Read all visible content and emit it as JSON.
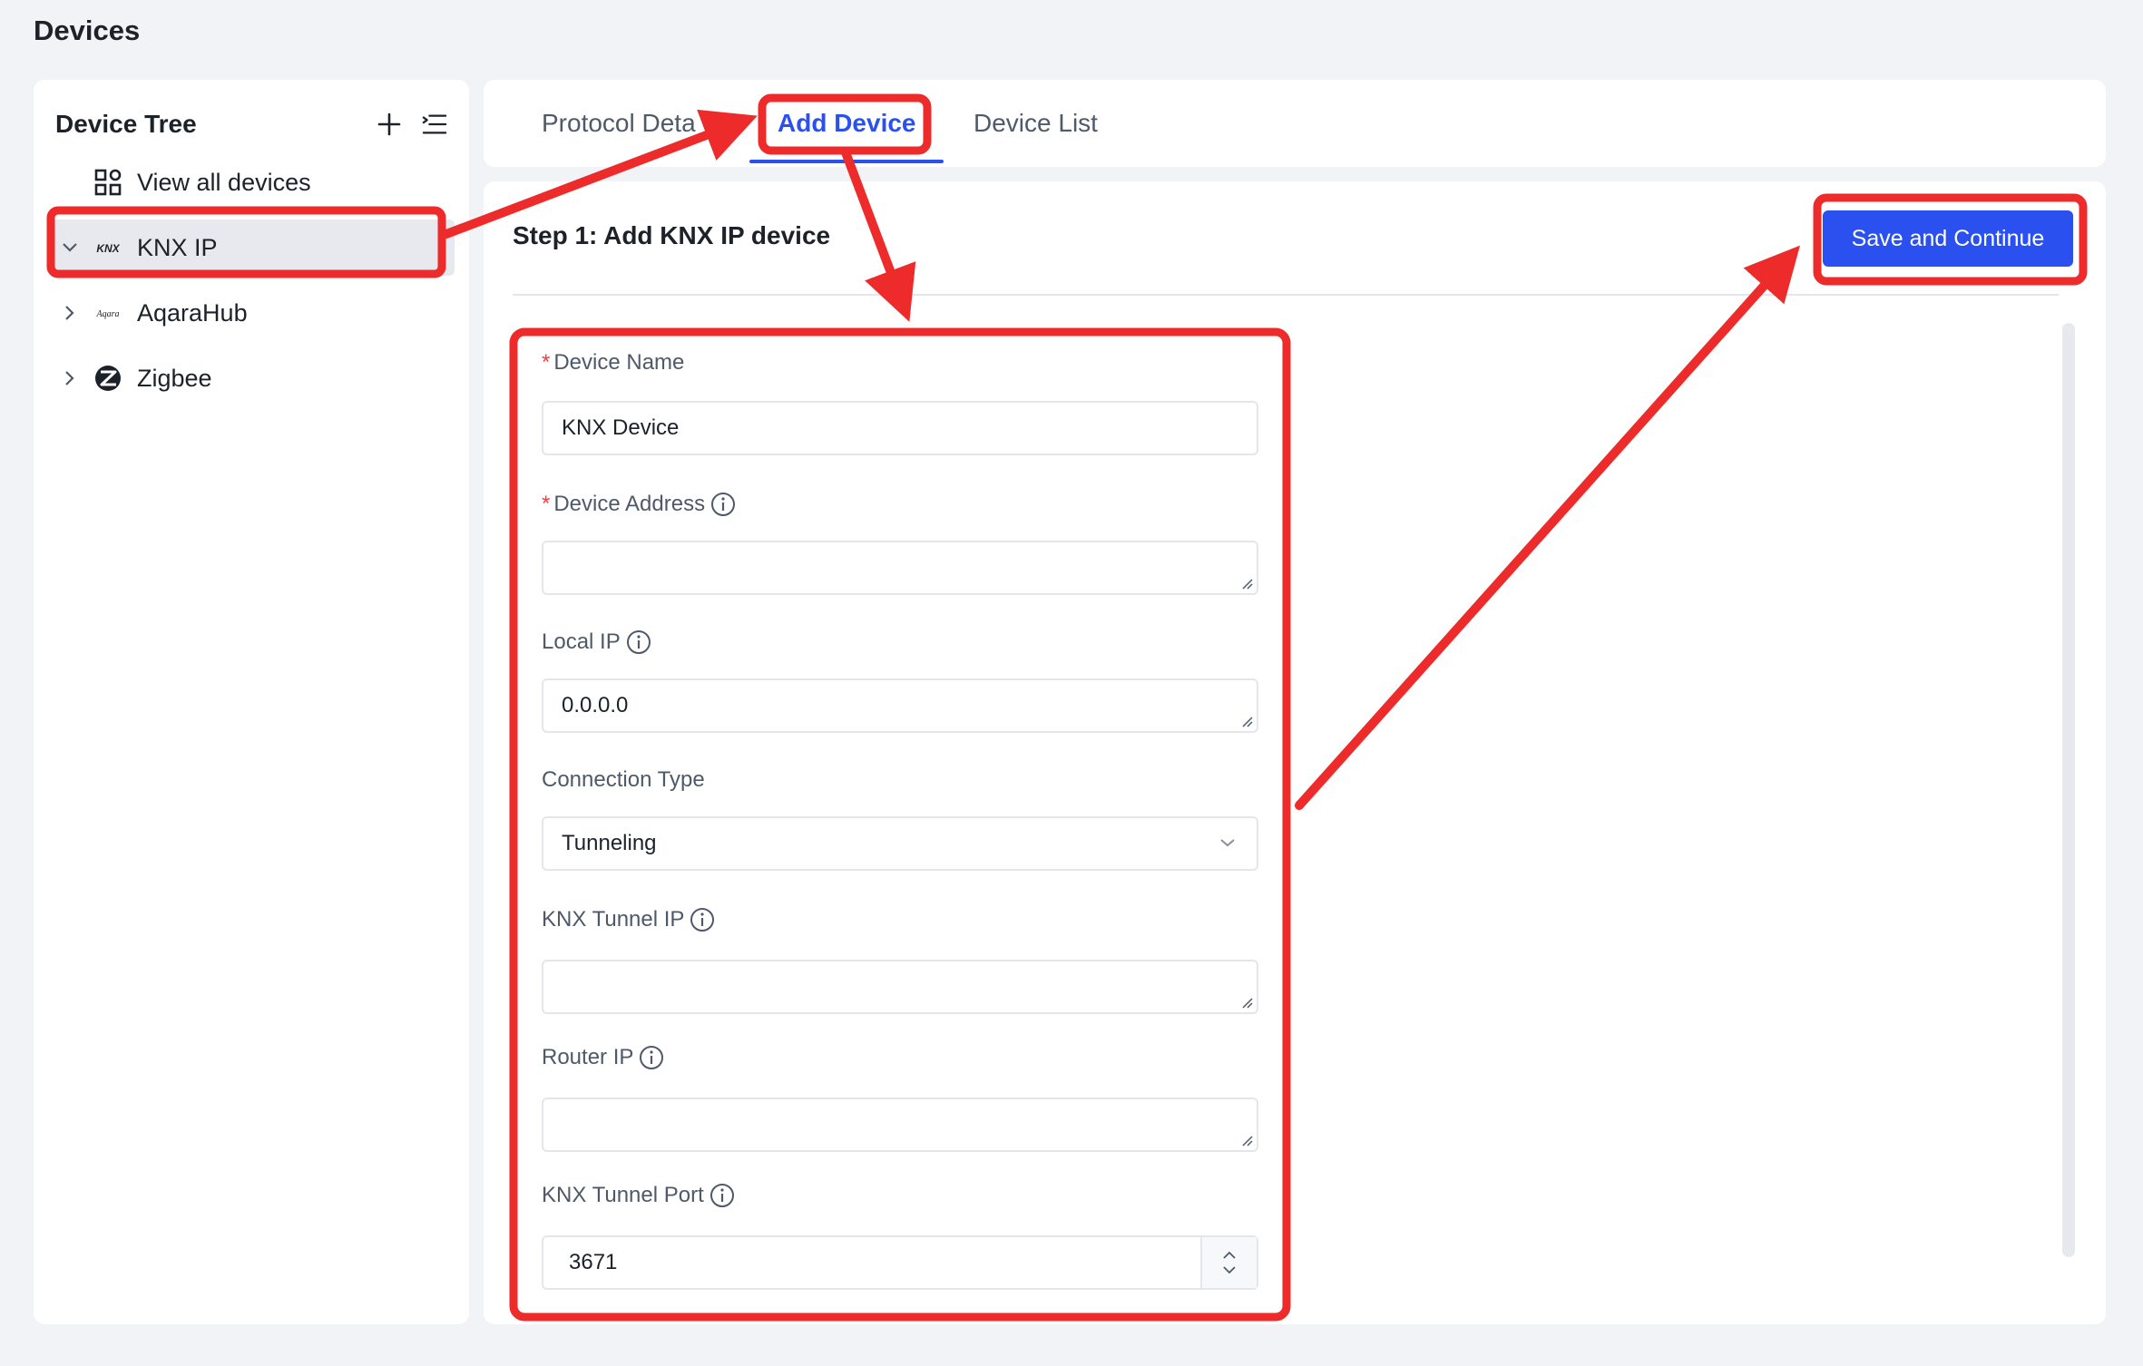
{
  "page": {
    "title": "Devices"
  },
  "sidebar": {
    "title": "Device Tree",
    "items": [
      {
        "label": "View all devices",
        "icon": "grid-icon"
      },
      {
        "label": "KNX IP",
        "icon": "knx-logo-icon",
        "icon_text": "KNX",
        "expanded": true,
        "selected": true
      },
      {
        "label": "AqaraHub",
        "icon": "aqara-logo-icon",
        "icon_text": "Aqara",
        "expanded": false
      },
      {
        "label": "Zigbee",
        "icon": "zigbee-logo-icon",
        "expanded": false
      }
    ]
  },
  "tabs": [
    {
      "label": "Protocol Deta"
    },
    {
      "label": "Add Device",
      "active": true
    },
    {
      "label": "Device List"
    }
  ],
  "main": {
    "step_title": "Step 1: Add KNX IP device",
    "save_label": "Save and Continue"
  },
  "form": {
    "device_name": {
      "label": "Device Name",
      "required": true,
      "value": "KNX Device"
    },
    "device_address": {
      "label": "Device Address",
      "required": true,
      "value": ""
    },
    "local_ip": {
      "label": "Local IP",
      "value": "0.0.0.0"
    },
    "connection_type": {
      "label": "Connection Type",
      "value": "Tunneling"
    },
    "knx_tunnel_ip": {
      "label": "KNX Tunnel IP",
      "value": ""
    },
    "router_ip": {
      "label": "Router IP",
      "value": ""
    },
    "knx_tunnel_port": {
      "label": "KNX Tunnel Port",
      "value": "3671"
    }
  },
  "colors": {
    "accent": "#2b50f0",
    "annotation": "#ee2b2b",
    "background": "#f2f3f7",
    "required": "#f53f3f"
  }
}
